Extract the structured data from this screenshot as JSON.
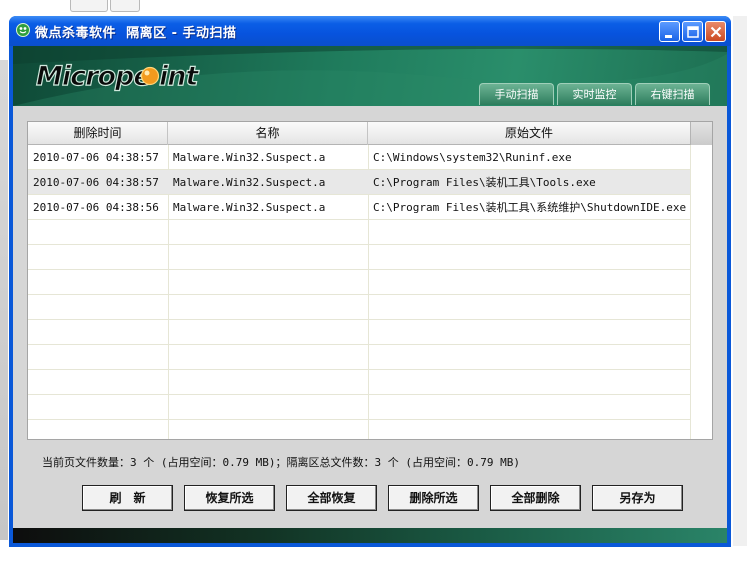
{
  "window": {
    "app_name": "微点杀毒软件",
    "title_rest": "隔离区 - 手动扫描"
  },
  "banner": {
    "logo_text": "Micropoint",
    "tabs": [
      {
        "label": "手动扫描"
      },
      {
        "label": "实时监控"
      },
      {
        "label": "右键扫描"
      }
    ]
  },
  "table": {
    "columns": [
      "删除时间",
      "名称",
      "原始文件"
    ],
    "rows": [
      {
        "time": "2010-07-06 04:38:57",
        "name": "Malware.Win32.Suspect.a",
        "path": "C:\\Windows\\system32\\Runinf.exe"
      },
      {
        "time": "2010-07-06 04:38:57",
        "name": "Malware.Win32.Suspect.a",
        "path": "C:\\Program Files\\装机工具\\Tools.exe"
      },
      {
        "time": "2010-07-06 04:38:56",
        "name": "Malware.Win32.Suspect.a",
        "path": "C:\\Program Files\\装机工具\\系统维护\\ShutdownIDE.exe"
      }
    ]
  },
  "status": {
    "text": "当前页文件数量：3 个 (占用空间：0.79 MB)；隔离区总文件数：3 个 (占用空间：0.79 MB)"
  },
  "buttons": {
    "refresh": "刷　新",
    "restore_selected": "恢复所选",
    "restore_all": "全部恢复",
    "delete_selected": "删除所选",
    "delete_all": "全部删除",
    "save_as": "另存为"
  },
  "colors": {
    "titlebar_blue": "#0753de",
    "banner_green": "#1f7b5c",
    "logo_orange": "#f39a1e"
  },
  "icons": {
    "app": "micropoint-app-icon",
    "minimize": "minimize-icon",
    "maximize": "maximize-icon",
    "close": "close-icon"
  }
}
